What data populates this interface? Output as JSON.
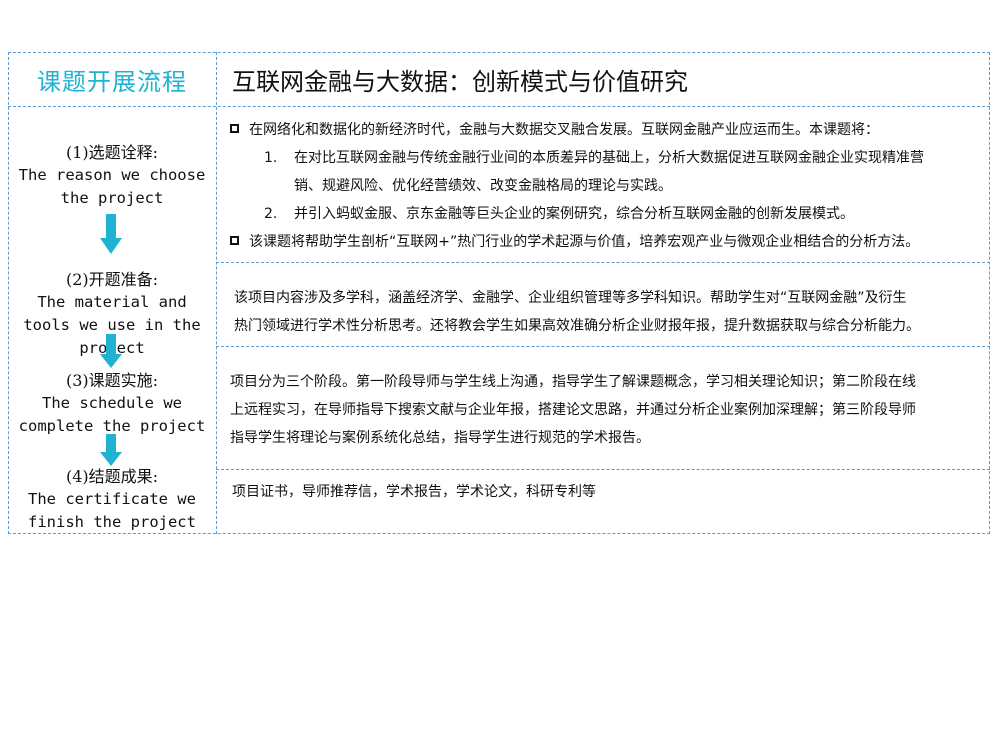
{
  "left_header": "课题开展流程",
  "main_title": "互联网金融与大数据：创新模式与价值研究",
  "steps": [
    {
      "cn": "(1)选题诠释:",
      "en": [
        "The reason we choose",
        "the project"
      ]
    },
    {
      "cn": "(2)开题准备:",
      "en": [
        "The material and",
        "tools we use in the",
        "project"
      ]
    },
    {
      "cn": "(3)课题实施:",
      "en": [
        "The schedule we",
        "complete the project"
      ]
    },
    {
      "cn": "(4)结题成果:",
      "en": [
        "The certificate we",
        "finish the project"
      ]
    }
  ],
  "arrow_color": "#1fb3d1",
  "row1": {
    "bullet1": "在网络化和数据化的新经济时代，金融与大数据交叉融合发展。互联网金融产业应运而生。本课题将：",
    "item1_num": "1.",
    "item1_line1": "在对比互联网金融与传统金融行业间的本质差异的基础上，分析大数据促进互联网金融企业实现精准营",
    "item1_line2": "销、规避风险、优化经营绩效、改变金融格局的理论与实践。",
    "item2_num": "2.",
    "item2": "并引入蚂蚁金服、京东金融等巨头企业的案例研究，综合分析互联网金融的创新发展模式。",
    "bullet2": "该课题将帮助学生剖析“互联网+”热门行业的学术起源与价值，培养宏观产业与微观企业相结合的分析方法。"
  },
  "row2": {
    "line1": "该项目内容涉及多学科，涵盖经济学、金融学、企业组织管理等多学科知识。帮助学生对“互联网金融”及衍生",
    "line2": "热门领域进行学术性分析思考。还将教会学生如果高效准确分析企业财报年报，提升数据获取与综合分析能力。"
  },
  "row3": {
    "line1": "项目分为三个阶段。第一阶段导师与学生线上沟通，指导学生了解课题概念，学习相关理论知识；第二阶段在线",
    "line2": "上远程实习，在导师指导下搜索文献与企业年报，搭建论文思路，并通过分析企业案例加深理解；第三阶段导师",
    "line3": "指导学生将理论与案例系统化总结，指导学生进行规范的学术报告。"
  },
  "row4": {
    "line1": "项目证书，导师推荐信，学术报告，学术论文，科研专利等"
  }
}
